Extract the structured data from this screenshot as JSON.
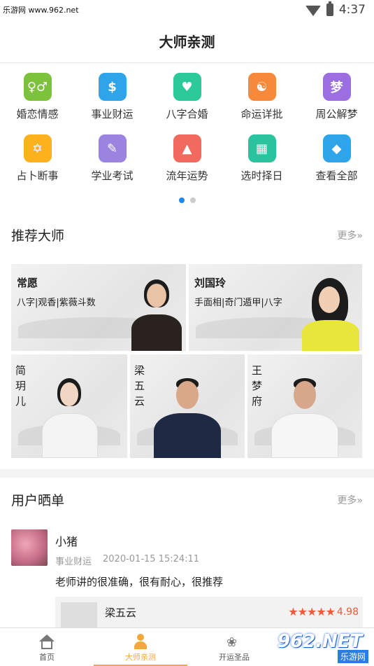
{
  "status": {
    "watermark": "乐游网 www.962.net",
    "time": "4:37"
  },
  "header": {
    "title": "大师亲测"
  },
  "categories": [
    {
      "label": "婚恋情感",
      "icon": "love-icon",
      "color": "#7cc33b",
      "glyph": "♀♂"
    },
    {
      "label": "事业财运",
      "icon": "money-icon",
      "color": "#2fa5e9",
      "glyph": "$"
    },
    {
      "label": "八字合婚",
      "icon": "marriage-icon",
      "color": "#2cc99a",
      "glyph": "♥"
    },
    {
      "label": "命运详批",
      "icon": "yinyang-icon",
      "color": "#f7893a",
      "glyph": "☯"
    },
    {
      "label": "周公解梦",
      "icon": "dream-icon",
      "color": "#9b6fe0",
      "glyph": "梦"
    },
    {
      "label": "占卜断事",
      "icon": "divination-icon",
      "color": "#fbb21c",
      "glyph": "✡"
    },
    {
      "label": "学业考试",
      "icon": "study-icon",
      "color": "#9b84e0",
      "glyph": "✎"
    },
    {
      "label": "流年运势",
      "icon": "trend-icon",
      "color": "#f26a5e",
      "glyph": "▲"
    },
    {
      "label": "选时择日",
      "icon": "calendar-icon",
      "color": "#2bc29e",
      "glyph": "▦"
    },
    {
      "label": "查看全部",
      "icon": "grid-icon",
      "color": "#2fa5e9",
      "glyph": "◆"
    }
  ],
  "masters": {
    "title": "推荐大师",
    "more": "更多»",
    "items": [
      {
        "name": "常愿",
        "desc": "八字|观香|紫薇斗数"
      },
      {
        "name": "刘国玲",
        "desc": "手面相|奇门遁甲|八字"
      },
      {
        "name": "简玥儿"
      },
      {
        "name": "梁五云"
      },
      {
        "name": "王梦府"
      }
    ]
  },
  "users": {
    "title": "用户晒单",
    "more": "更多»",
    "review": {
      "name": "小猪",
      "category": "事业财运",
      "time": "2020-01-15 15:24:11",
      "text": "老师讲的很准确，很有耐心，很推荐",
      "master": "梁五云",
      "stars": "★★★★★",
      "score": "4.98"
    }
  },
  "tabs": [
    {
      "label": "首页"
    },
    {
      "label": "大师亲测"
    },
    {
      "label": "开运圣品"
    }
  ],
  "bottom_watermark": {
    "big": "962.NET",
    "small": "乐游网"
  }
}
